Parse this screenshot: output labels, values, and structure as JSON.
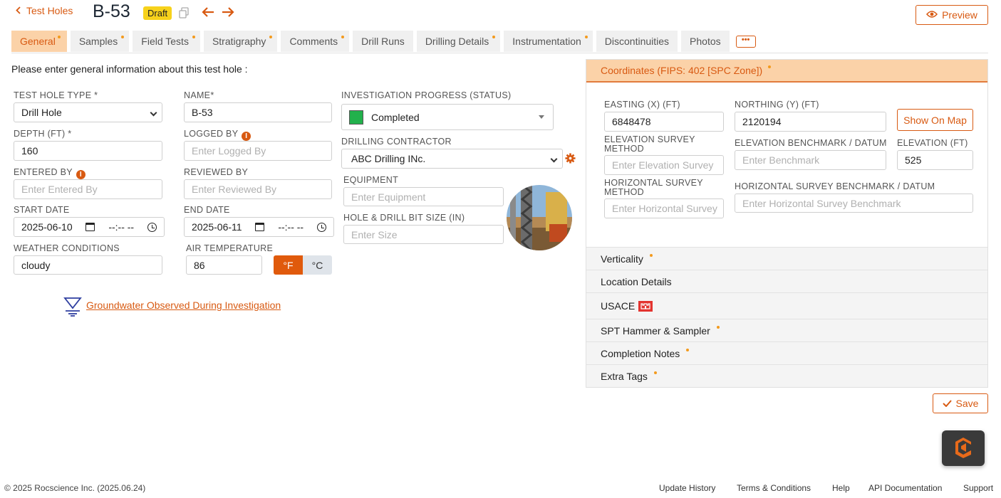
{
  "header": {
    "back_label": "Test Holes",
    "title": "B-53",
    "status_badge": "Draft",
    "preview_label": "Preview"
  },
  "tabs": [
    {
      "label": "General",
      "dot": true,
      "active": true
    },
    {
      "label": "Samples",
      "dot": true
    },
    {
      "label": "Field Tests",
      "dot": true
    },
    {
      "label": "Stratigraphy",
      "dot": true
    },
    {
      "label": "Comments",
      "dot": true
    },
    {
      "label": "Drill Runs",
      "dot": false
    },
    {
      "label": "Drilling Details",
      "dot": true
    },
    {
      "label": "Instrumentation",
      "dot": true
    },
    {
      "label": "Discontinuities",
      "dot": false
    },
    {
      "label": "Photos",
      "dot": false
    }
  ],
  "more_label": "•••",
  "intro_text": "Please enter general information about this test hole :",
  "form": {
    "test_hole_type": {
      "label": "TEST HOLE TYPE *",
      "value": "Drill Hole"
    },
    "name": {
      "label": "NAME*",
      "value": "B-53"
    },
    "depth": {
      "label": "DEPTH (FT) *",
      "value": "160"
    },
    "logged_by": {
      "label": "LOGGED BY",
      "placeholder": "Enter Logged By"
    },
    "entered_by": {
      "label": "ENTERED BY",
      "placeholder": "Enter Entered By"
    },
    "reviewed_by": {
      "label": "REVIEWED BY",
      "placeholder": "Enter Reviewed By"
    },
    "start_date": {
      "label": "START DATE",
      "date": "2025-06-10",
      "time": "--:-- --"
    },
    "end_date": {
      "label": "END DATE",
      "date": "2025-06-11",
      "time": "--:-- --"
    },
    "weather": {
      "label": "WEATHER CONDITIONS",
      "value": "cloudy"
    },
    "air_temperature": {
      "label": "AIR TEMPERATURE",
      "value": "86",
      "unit_f": "°F",
      "unit_c": "°C"
    },
    "progress": {
      "label": "INVESTIGATION PROGRESS (STATUS)",
      "value": "Completed",
      "color": "#22b14c"
    },
    "contractor": {
      "label": "DRILLING CONTRACTOR",
      "value": "ABC Drilling INc."
    },
    "equipment": {
      "label": "EQUIPMENT",
      "placeholder": "Enter Equipment"
    },
    "bit_size": {
      "label": "HOLE & DRILL BIT SIZE (IN)",
      "placeholder": "Enter Size"
    }
  },
  "groundwater_link": "Groundwater Observed During Investigation",
  "coordinates": {
    "header": "Coordinates (FIPS: 402 [SPC Zone])",
    "easting": {
      "label": "EASTING (X) (FT)",
      "value": "6848478"
    },
    "northing": {
      "label": "NORTHING (Y) (FT)",
      "value": "2120194"
    },
    "show_map_label": "Show On Map",
    "elev_method": {
      "label": "ELEVATION SURVEY METHOD",
      "placeholder": "Enter Elevation Survey"
    },
    "elev_bench": {
      "label": "ELEVATION BENCHMARK / DATUM",
      "placeholder": "Enter Benchmark"
    },
    "elevation": {
      "label": "ELEVATION (FT)",
      "value": "525"
    },
    "horiz_method": {
      "label": "HORIZONTAL SURVEY METHOD",
      "placeholder": "Enter Horizontal Survey"
    },
    "horiz_bench": {
      "label": "HORIZONTAL SURVEY BENCHMARK / DATUM",
      "placeholder": "Enter Horizontal Survey Benchmark"
    }
  },
  "accordions": [
    {
      "label": "Verticality",
      "dot": true
    },
    {
      "label": "Location Details",
      "dot": false
    },
    {
      "label": "USACE",
      "dot": false
    },
    {
      "label": "SPT Hammer & Sampler",
      "dot": true
    },
    {
      "label": "Completion Notes",
      "dot": true
    },
    {
      "label": "Extra Tags",
      "dot": true
    }
  ],
  "save_label": "Save",
  "footer": {
    "copyright": "© 2025 Rocscience Inc. (2025.06.24)",
    "links": [
      "Update History",
      "Terms & Conditions",
      "Help",
      "API Documentation",
      "Support"
    ]
  },
  "colors": {
    "accent": "#d85a12",
    "tab_active_bg": "#fbd2a8",
    "badge": "#f7d21b"
  }
}
